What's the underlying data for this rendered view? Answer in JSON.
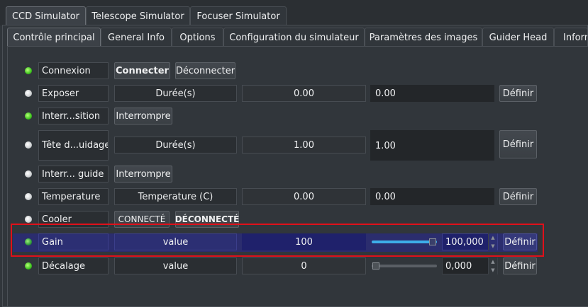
{
  "top_tabs": [
    "CCD Simulator",
    "Telescope Simulator",
    "Focuser Simulator"
  ],
  "sub_tabs": [
    "Contrôle principal",
    "General Info",
    "Options",
    "Configuration du simulateur",
    "Paramètres des images",
    "Guider Head",
    "Inform"
  ],
  "rows": {
    "connexion": {
      "label": "Connexion",
      "btn1": "Connecter",
      "btn2": "Déconnecter"
    },
    "exposer": {
      "label": "Exposer",
      "field": "Durée(s)",
      "value": "0.00",
      "input": "0.00",
      "set": "Définir"
    },
    "interr_acq": {
      "label": "Interr...sition",
      "btn": "Interrompre"
    },
    "tete_guidage": {
      "label": "Tête d...uidage",
      "field": "Durée(s)",
      "value": "1.00",
      "input": "1.00",
      "set": "Définir"
    },
    "interr_guide": {
      "label": "Interr... guide",
      "btn": "Interrompre"
    },
    "temperature": {
      "label": "Temperature",
      "field": "Temperature (C)",
      "value": "0.00",
      "input": "0.00",
      "set": "Définir"
    },
    "cooler": {
      "label": "Cooler",
      "btn1": "CONNECTÉ",
      "btn2": "DÉCONNECTÉ"
    },
    "gain": {
      "label": "Gain",
      "field": "value",
      "value": "100",
      "spin": "100,000",
      "slider_fraction": 1.0,
      "set": "Définir"
    },
    "decalage": {
      "label": "Décalage",
      "field": "value",
      "value": "0",
      "spin": "0,000",
      "slider_fraction": 0.0,
      "set": "Définir"
    }
  },
  "colors": {
    "accent": "#3daee9",
    "highlight": "#2b2d6e",
    "annotation": "#e0101a",
    "led_on": "#3ec61e"
  }
}
